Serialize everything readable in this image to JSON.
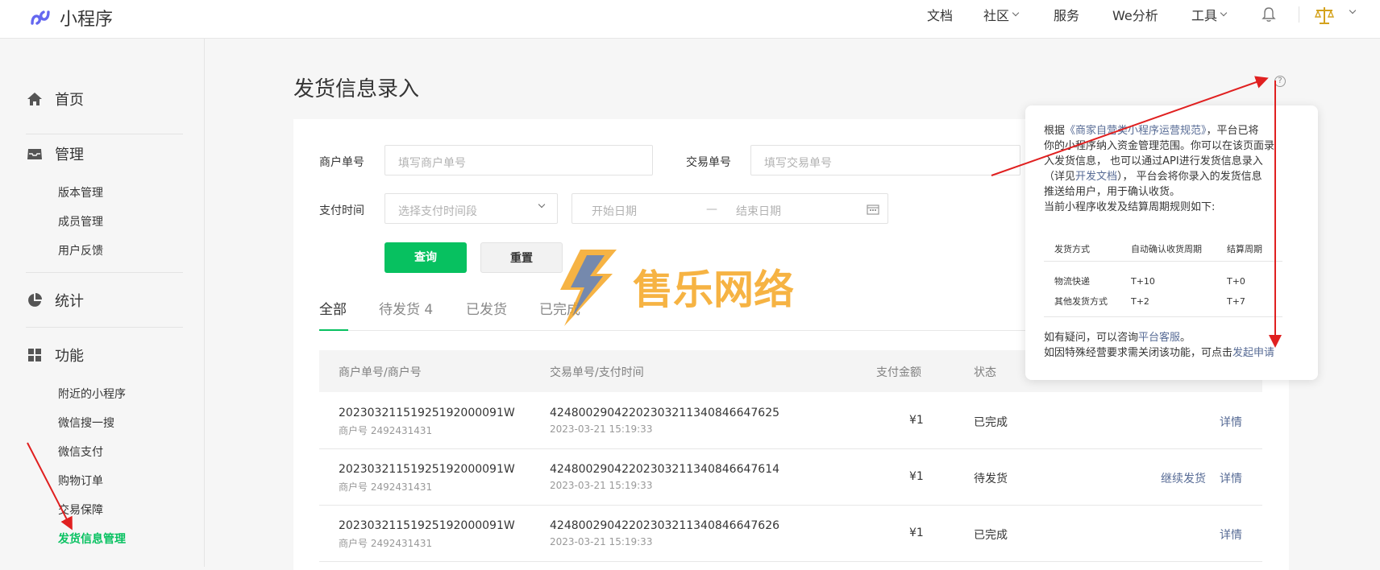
{
  "topbar": {
    "brand": "小程序",
    "nav": [
      {
        "label": "文档",
        "dropdown": false
      },
      {
        "label": "社区",
        "dropdown": true
      },
      {
        "label": "服务",
        "dropdown": false
      },
      {
        "label": "We分析",
        "dropdown": false
      },
      {
        "label": "工具",
        "dropdown": true
      }
    ],
    "icons": [
      "bell-icon",
      "avatar-scales-icon"
    ]
  },
  "sidebar": {
    "groups": [
      {
        "label": "首页",
        "icon": "home-icon"
      },
      {
        "label": "管理",
        "icon": "inbox-icon",
        "items": [
          "版本管理",
          "成员管理",
          "用户反馈"
        ]
      },
      {
        "label": "统计",
        "icon": "pie-chart-icon"
      },
      {
        "label": "功能",
        "icon": "grid-icon",
        "items": [
          "附近的小程序",
          "微信搜一搜",
          "微信支付",
          "购物订单",
          "交易保障",
          "发货信息管理"
        ]
      }
    ],
    "active_item": "发货信息管理"
  },
  "page": {
    "title": "发货信息录入",
    "help_icon": "?"
  },
  "filters": {
    "merchant_order_label": "商户单号",
    "merchant_order_placeholder": "填写商户单号",
    "trade_no_label": "交易单号",
    "trade_no_placeholder": "填写交易单号",
    "pay_time_label": "支付时间",
    "pay_time_select": "选择支付时间段",
    "start_date": "开始日期",
    "date_sep": "—",
    "end_date": "结束日期",
    "query_button": "查询",
    "reset_button": "重置"
  },
  "tabs": [
    {
      "label": "全部",
      "active": true
    },
    {
      "label": "待发货 4",
      "active": false
    },
    {
      "label": "已发货",
      "active": false
    },
    {
      "label": "已完成",
      "active": false
    }
  ],
  "table": {
    "headers": [
      "商户单号/商户号",
      "交易单号/支付时间",
      "支付金额",
      "状态"
    ],
    "rows": [
      {
        "order_no": "20230321151925192000091W",
        "merchant": "商户号 2492431431",
        "trade_no": "4248002904220230321134084664762​5",
        "pay_time": "2023-03-21 15:19:33",
        "amount": "¥1",
        "status": "已完成",
        "actions": [
          "详情"
        ]
      },
      {
        "order_no": "20230321151925192000091W",
        "merchant": "商户号 2492431431",
        "trade_no": "42480029042202303211340846647614",
        "pay_time": "2023-03-21 15:19:33",
        "amount": "¥1",
        "status": "待发货",
        "actions": [
          "继续发货",
          "详情"
        ]
      },
      {
        "order_no": "20230321151925192000091W",
        "merchant": "商户号 2492431431",
        "trade_no": "42480029042202303211340846647626",
        "pay_time": "2023-03-21 15:19:33",
        "amount": "¥1",
        "status": "已完成",
        "actions": [
          "详情"
        ]
      }
    ]
  },
  "tooltip": {
    "line1a": "根据",
    "line1_link": "《商家自营类小程序运营规范》",
    "line1b": "，平台已将",
    "line2": "你的小程序纳入资金管理范围。你可以在该页面录",
    "line3": "入发货信息，  也可以通过API进行发货信息录入",
    "line4a": "（详见",
    "line4_link": "开发文档",
    "line4b": "），  平台会将你录入的发货信息",
    "line5": "推送给用户，用于确认收货。",
    "line6": "当前小程序收发及结算周期规则如下:",
    "table_headers": [
      "发货方式",
      "自动确认收货周期",
      "结算周期"
    ],
    "table_rows": [
      [
        "物流快递",
        "T+10",
        "T+0"
      ],
      [
        "其他发货方式",
        "T+2",
        "T+7"
      ]
    ],
    "footer1a": "如有疑问，可以咨询",
    "footer1_link": "平台客服",
    "footer1b": "。",
    "footer2a": "如因特殊经营要求需关闭该功能，可点击",
    "footer2_link": "发起申请"
  },
  "watermark": {
    "text": "售乐网络"
  },
  "colors": {
    "primary_green": "#07c160",
    "link_blue": "#576b95",
    "arrow_red": "#e02020",
    "watermark_orange": "#f5a623",
    "watermark_blue": "#4a7bd0"
  }
}
